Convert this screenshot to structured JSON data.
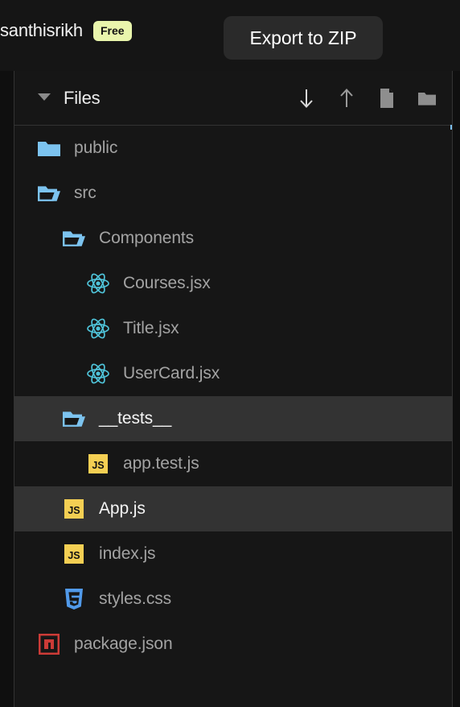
{
  "header": {
    "username": "santhisrikh",
    "plan_badge": "Free",
    "plan_badge_bg": "#e9f5ac",
    "export_button": "Export to ZIP"
  },
  "panel": {
    "title": "Files",
    "collapse_icon": "caret-down-icon",
    "toolbar": [
      {
        "name": "download-icon",
        "glyph": "arrow-down"
      },
      {
        "name": "upload-icon",
        "glyph": "arrow-up"
      },
      {
        "name": "new-file-icon",
        "glyph": "file"
      },
      {
        "name": "new-folder-icon",
        "glyph": "folder"
      }
    ]
  },
  "tree": {
    "items": [
      {
        "label": "public",
        "icon": "folder-closed-icon",
        "indent": 0,
        "active": false
      },
      {
        "label": "src",
        "icon": "folder-open-icon",
        "indent": 0,
        "active": false
      },
      {
        "label": "Components",
        "icon": "folder-open-icon",
        "indent": 1,
        "active": false
      },
      {
        "label": "Courses.jsx",
        "icon": "react-icon",
        "indent": 2,
        "active": false
      },
      {
        "label": "Title.jsx",
        "icon": "react-icon",
        "indent": 2,
        "active": false
      },
      {
        "label": "UserCard.jsx",
        "icon": "react-icon",
        "indent": 2,
        "active": false
      },
      {
        "label": "__tests__",
        "icon": "folder-open-icon",
        "indent": 1,
        "active": true
      },
      {
        "label": "app.test.js",
        "icon": "js-icon",
        "indent": 2,
        "active": false
      },
      {
        "label": "App.js",
        "icon": "js-icon",
        "indent": 1,
        "active": true
      },
      {
        "label": "index.js",
        "icon": "js-icon",
        "indent": 1,
        "active": false
      },
      {
        "label": "styles.css",
        "icon": "css-icon",
        "indent": 1,
        "active": false
      },
      {
        "label": "package.json",
        "icon": "npm-icon",
        "indent": 0,
        "active": false
      }
    ]
  },
  "colors": {
    "panel_bg": "#161616",
    "row_active_bg": "#333333",
    "border": "#333333",
    "folder_blue": "#7cc3ef",
    "react_cyan": "#4fc3d9",
    "js_yellow": "#f4cf53",
    "css_blue": "#519aea",
    "npm_red": "#cc3b37",
    "text_muted": "#a3a3a3",
    "text_bright": "#f5f5f5",
    "accent": "#7cc0f0"
  }
}
